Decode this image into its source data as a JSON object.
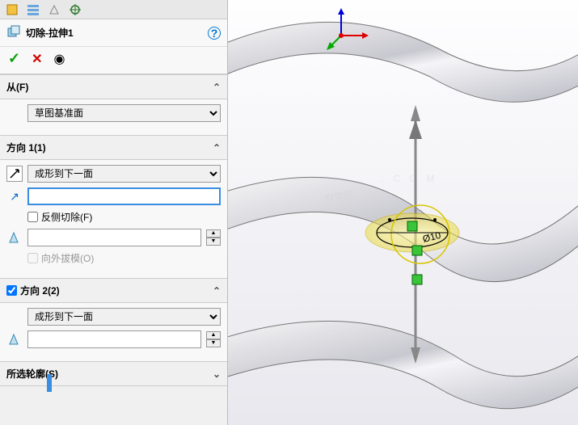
{
  "feature": {
    "icon": "cut-extrude-icon",
    "title": "切除-拉伸1"
  },
  "sections": {
    "from": {
      "label": "从(F)",
      "plane": "草图基准面"
    },
    "dir1": {
      "label": "方向 1(1)",
      "end_condition": "成形到下一面",
      "face_value": "",
      "flip_side": "反侧切除(F)",
      "draft_value": "",
      "draft_outward": "向外拔模(O)"
    },
    "dir2": {
      "label": "方向 2(2)",
      "enabled": true,
      "end_condition": "成形到下一面",
      "draft_value": ""
    },
    "contours": {
      "label": "所选轮廓(S)"
    }
  },
  "viewport": {
    "watermark": "自学网",
    "dim_label": "Ø10"
  },
  "glyphs": {
    "ok": "✓",
    "cancel": "✕",
    "eye": "◉",
    "help": "?",
    "chev_up": "⌃",
    "chev_down": "⌄",
    "flip_arrow": "↗",
    "dir_arrow": "↗"
  }
}
